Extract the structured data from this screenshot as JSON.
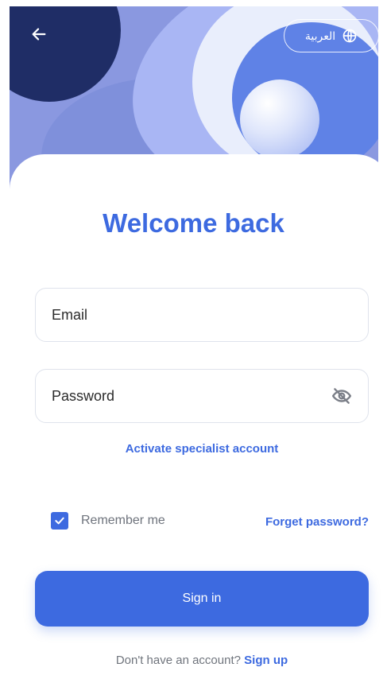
{
  "header": {
    "back_icon": "arrow-left-icon",
    "language": {
      "icon": "globe-icon",
      "label": "العربية"
    }
  },
  "main": {
    "title": "Welcome back",
    "email": {
      "label": "Email"
    },
    "password": {
      "label": "Password",
      "toggle_icon": "eye-off-icon"
    },
    "activate_link": "Activate specialist account",
    "remember": {
      "label": "Remember me",
      "checked": true
    },
    "forget_link": "Forget password?",
    "signin_label": "Sign in",
    "footer": {
      "prompt": "Don't have an account?",
      "signup_link": "Sign up"
    }
  },
  "colors": {
    "accent": "#3d6ae0",
    "text_muted": "#6e737c"
  }
}
